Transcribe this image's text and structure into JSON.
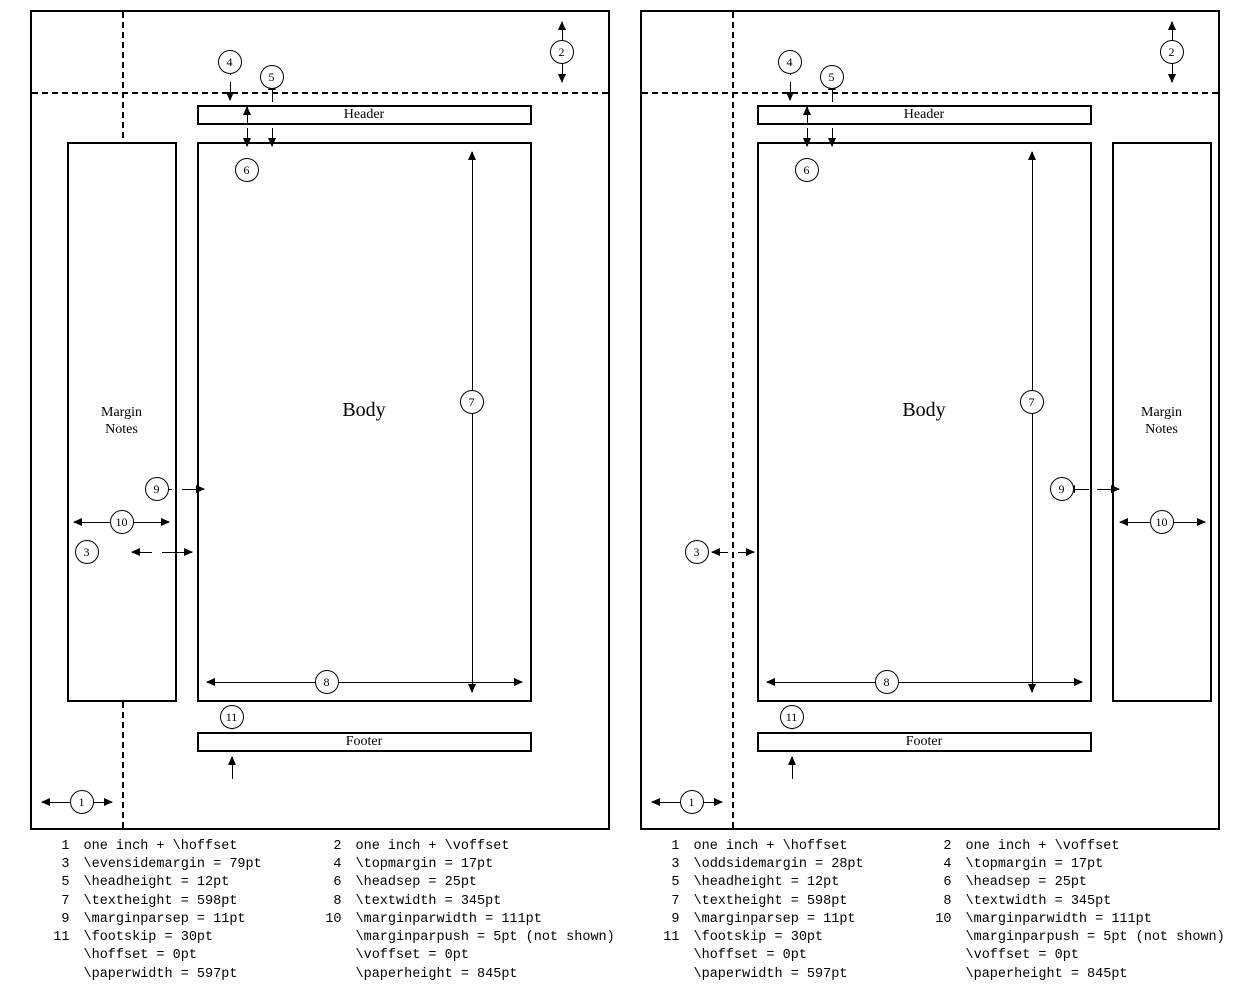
{
  "labels": {
    "header": "Header",
    "body": "Body",
    "footer": "Footer",
    "margin_notes_l1": "Margin",
    "margin_notes_l2": "Notes"
  },
  "circles": [
    "1",
    "2",
    "3",
    "4",
    "5",
    "6",
    "7",
    "8",
    "9",
    "10",
    "11"
  ],
  "legend_even": [
    {
      "n": "1",
      "t": "one inch + \\hoffset"
    },
    {
      "n": "2",
      "t": "one inch + \\voffset"
    },
    {
      "n": "3",
      "t": "\\evensidemargin = 79pt"
    },
    {
      "n": "4",
      "t": "\\topmargin = 17pt"
    },
    {
      "n": "5",
      "t": "\\headheight = 12pt"
    },
    {
      "n": "6",
      "t": "\\headsep = 25pt"
    },
    {
      "n": "7",
      "t": "\\textheight = 598pt"
    },
    {
      "n": "8",
      "t": "\\textwidth = 345pt"
    },
    {
      "n": "9",
      "t": "\\marginparsep = 11pt"
    },
    {
      "n": "10",
      "t": "\\marginparwidth = 111pt"
    },
    {
      "n": "11",
      "t": "\\footskip = 30pt"
    },
    {
      "n": "",
      "t": "\\marginparpush = 5pt (not shown)"
    },
    {
      "n": "",
      "t": "\\hoffset = 0pt"
    },
    {
      "n": "",
      "t": "\\voffset = 0pt"
    },
    {
      "n": "",
      "t": "\\paperwidth = 597pt"
    },
    {
      "n": "",
      "t": "\\paperheight = 845pt"
    }
  ],
  "legend_odd": [
    {
      "n": "1",
      "t": "one inch + \\hoffset"
    },
    {
      "n": "2",
      "t": "one inch + \\voffset"
    },
    {
      "n": "3",
      "t": "\\oddsidemargin = 28pt"
    },
    {
      "n": "4",
      "t": "\\topmargin = 17pt"
    },
    {
      "n": "5",
      "t": "\\headheight = 12pt"
    },
    {
      "n": "6",
      "t": "\\headsep = 25pt"
    },
    {
      "n": "7",
      "t": "\\textheight = 598pt"
    },
    {
      "n": "8",
      "t": "\\textwidth = 345pt"
    },
    {
      "n": "9",
      "t": "\\marginparsep = 11pt"
    },
    {
      "n": "10",
      "t": "\\marginparwidth = 111pt"
    },
    {
      "n": "11",
      "t": "\\footskip = 30pt"
    },
    {
      "n": "",
      "t": "\\marginparpush = 5pt (not shown)"
    },
    {
      "n": "",
      "t": "\\hoffset = 0pt"
    },
    {
      "n": "",
      "t": "\\voffset = 0pt"
    },
    {
      "n": "",
      "t": "\\paperwidth = 597pt"
    },
    {
      "n": "",
      "t": "\\paperheight = 845pt"
    }
  ]
}
